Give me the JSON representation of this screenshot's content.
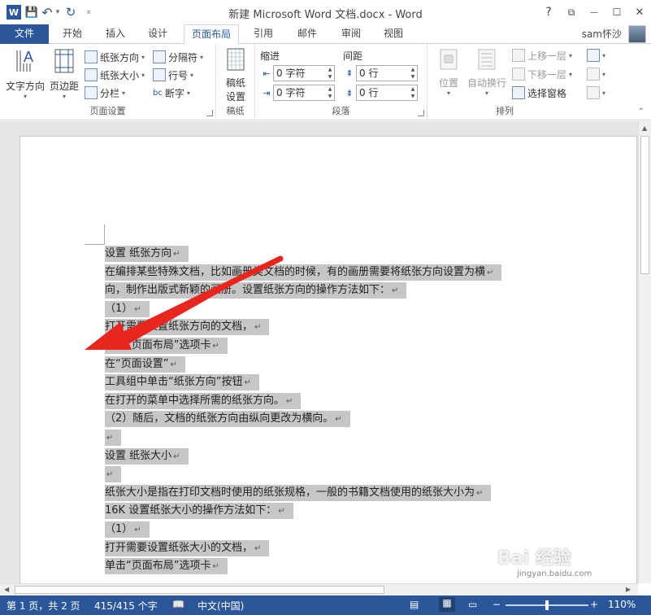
{
  "window": {
    "title": "新建 Microsoft Word 文档.docx - Word",
    "help": "?",
    "restore": "⧉",
    "minimize": "—",
    "maximize": "☐",
    "close": "✕"
  },
  "qat": {
    "logo": "W",
    "save": "💾",
    "undo": "↶",
    "undo_caret": "▾",
    "redo": "↻",
    "customize": "⌅"
  },
  "tabs": [
    {
      "label": "文件"
    },
    {
      "label": "开始"
    },
    {
      "label": "插入"
    },
    {
      "label": "设计"
    },
    {
      "label": "页面布局"
    },
    {
      "label": "引用"
    },
    {
      "label": "邮件"
    },
    {
      "label": "审阅"
    },
    {
      "label": "视图"
    }
  ],
  "user": {
    "name": "sam怀沙"
  },
  "ribbon": {
    "page_setup": {
      "label": "页面设置",
      "text_direction": "文字方向",
      "margins": "页边距",
      "orientation": "纸张方向",
      "size": "纸张大小",
      "columns": "分栏",
      "breaks": "分隔符",
      "line_numbers": "行号",
      "hyphenation": "断字"
    },
    "manuscript": {
      "label": "稿纸",
      "settings": "稿纸\n设置",
      "settings_l1": "稿纸",
      "settings_l2": "设置"
    },
    "paragraph": {
      "label": "段落",
      "indent_header": "缩进",
      "spacing_header": "间距",
      "indent_left": "0 字符",
      "indent_right": "0 字符",
      "spacing_before": "0 行",
      "spacing_after": "0 行"
    },
    "arrange": {
      "label": "排列",
      "position": "位置",
      "wrap_text": "自动换行",
      "bring_forward": "上移一层",
      "send_backward": "下移一层",
      "selection_pane": "选择窗格"
    }
  },
  "document": {
    "lines": [
      "设置 纸张方向",
      "在编排某些特殊文档，比如画册类文档的时候，有的画册需要将纸张方向设置为横",
      "向，制作出版式新颖的画册。设置纸张方向的操作方法如下：",
      "（1）",
      "打开需要设置纸张方向的文档，",
      "单击“页面布局”选项卡",
      "在“页面设置”",
      "工具组中单击“纸张方向”按钮",
      "在打开的菜单中选择所需的纸张方向。",
      "（2）随后，文档的纸张方向由纵向更改为横向。",
      "",
      "设置 纸张大小",
      "",
      "纸张大小是指在打印文档时使用的纸张规格，一般的书籍文档使用的纸张大小为",
      "16K 设置纸张大小的操作方法如下：",
      "（1）",
      "打开需要设置纸张大小的文档，",
      "单击“页面布局”选项卡"
    ],
    "paragraph_mark": "↵"
  },
  "status": {
    "page": "第 1 页，共 2 页",
    "words": "415/415 个字",
    "language": "中文(中国)",
    "zoom": "110%",
    "zoom_minus": "−",
    "zoom_plus": "+",
    "zoom_level": 0.48
  },
  "watermark": {
    "text": "Bai 经验",
    "url": "jingyan.baidu.com"
  },
  "colors": {
    "accent": "#2b579a",
    "highlight": "#c6c6c6",
    "arrow": "#e8261e"
  }
}
